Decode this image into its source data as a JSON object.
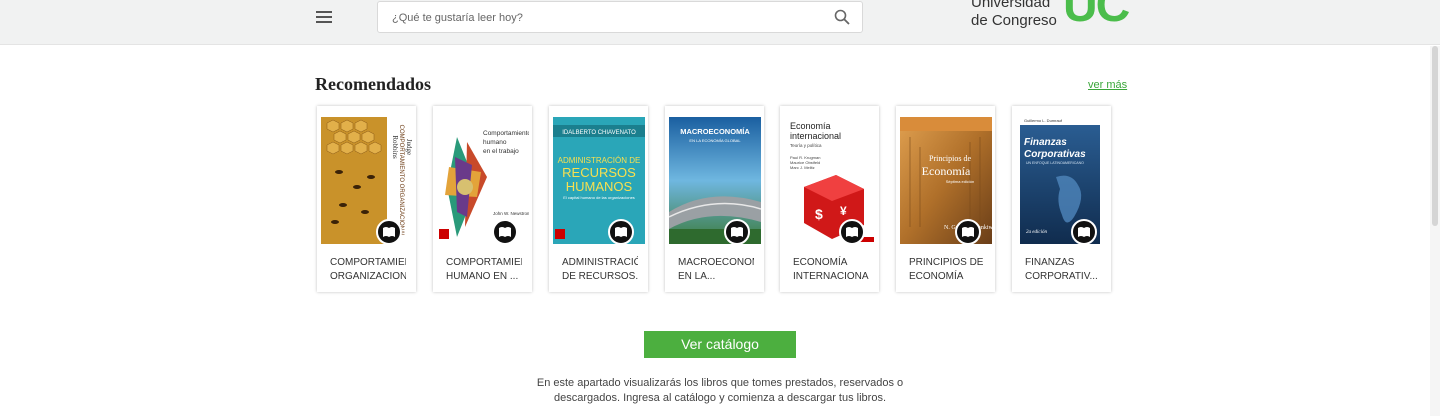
{
  "header": {
    "search_placeholder": "¿Qué te gustaría leer hoy?",
    "logo_line1": "Universidad",
    "logo_line2": "de Congreso",
    "logo_mark": "UC",
    "brand_color": "#4bbd4b"
  },
  "section": {
    "title": "Recomendados",
    "more_link": "ver más"
  },
  "books": [
    {
      "line1": "COMPORTAMIENTO",
      "line2": "ORGANIZACIONAL",
      "cover_color": "#c8861f",
      "cover_title": "COMPORTAMIENTO ORGANIZACIONAL",
      "authors": "Robbins · Judge"
    },
    {
      "line1": "COMPORTAMIENTO",
      "line2": "HUMANO EN ...",
      "cover_color": "#ffffff",
      "cover_title": "Comportamiento humano en el trabajo",
      "authors": "John W. Newstrom"
    },
    {
      "line1": "ADMINISTRACIÓN",
      "line2": "DE RECURSOS...",
      "cover_color": "#2aa6b8",
      "cover_title": "ADMINISTRACIÓN DE RECURSOS HUMANOS",
      "authors": "IDALBERTO CHIAVENATO"
    },
    {
      "line1": "MACROECONOMÍA",
      "line2": "EN LA...",
      "cover_color": "#2b6ea5",
      "cover_title": "MACROECONOMÍA",
      "authors": "Felipe Larrain B. · Jeffrey D. Sachs"
    },
    {
      "line1": "ECONOMÍA",
      "line2": "INTERNACIONAL",
      "cover_color": "#ffffff",
      "cover_title": "Economía internacional",
      "authors": "Paul R. Krugman · Maurice Obstfeld · Marc J. Melitz"
    },
    {
      "line1": "PRINCIPIOS DE",
      "line2": "ECONOMÍA",
      "cover_color": "#b5772c",
      "cover_title": "Principios de Economía",
      "authors": "N. Gregory Mankiw"
    },
    {
      "line1": "FINANZAS",
      "line2": "CORPORATIV...",
      "cover_color": "#1f4a7a",
      "cover_title": "Finanzas Corporativas",
      "authors": "Guillermo L. Dumrauf"
    }
  ],
  "catalog_button": "Ver catálogo",
  "info_line1": "En este apartado visualizarás los libros que tomes prestados, reservados o",
  "info_line2": "descargados. Ingresa al catálogo y comienza a descargar tus libros.",
  "accent_color": "#4caf3f"
}
